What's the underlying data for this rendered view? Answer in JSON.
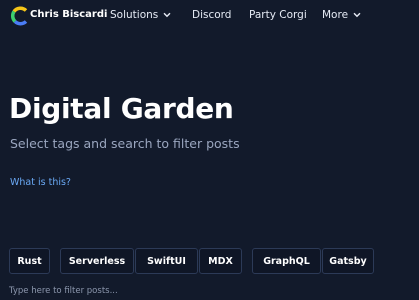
{
  "nav": {
    "brand": "Chris Biscardi",
    "items": [
      {
        "label": "Solutions",
        "has_dropdown": true
      },
      {
        "label": "Discord",
        "has_dropdown": false
      },
      {
        "label": "Party Corgi",
        "has_dropdown": false
      },
      {
        "label": "More",
        "has_dropdown": true
      }
    ]
  },
  "hero": {
    "title": "Digital Garden",
    "subtitle": "Select tags and search to filter posts",
    "link": "What is this?"
  },
  "tags": [
    "Rust",
    "Serverless",
    "SwiftUI",
    "MDX",
    "GraphQL",
    "Gatsby"
  ],
  "filter": {
    "placeholder": "Type here to filter posts...",
    "value": ""
  },
  "colors": {
    "background": "#121a2b",
    "link": "#6aa9f5",
    "tag_border": "#2c3a57",
    "logo_yellow": "#f5c518",
    "logo_green": "#3ecf6e",
    "logo_blue": "#4a7df5"
  },
  "icons": {
    "logo": "brand-c-logo-icon",
    "dropdown": "chevron-down-icon"
  }
}
